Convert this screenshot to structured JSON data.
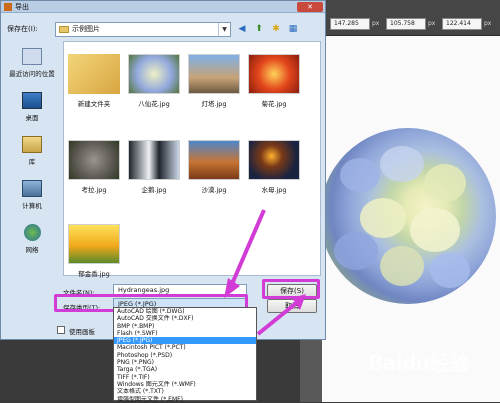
{
  "dialog": {
    "title": "导出",
    "lookin_label": "保存在(I):",
    "current_folder": "示例图片",
    "places": [
      {
        "label": "最近访问的位置"
      },
      {
        "label": "桌面"
      },
      {
        "label": "库"
      },
      {
        "label": "计算机"
      },
      {
        "label": "网络"
      }
    ],
    "files": [
      {
        "name": "新建文件夹"
      },
      {
        "name": "八仙花.jpg"
      },
      {
        "name": "灯塔.jpg"
      },
      {
        "name": "菊花.jpg"
      },
      {
        "name": "考拉.jpg"
      },
      {
        "name": "企鹅.jpg"
      },
      {
        "name": "沙漠.jpg"
      },
      {
        "name": "水母.jpg"
      },
      {
        "name": "郁金香.jpg"
      }
    ],
    "filename_label": "文件名(N):",
    "filename_value": "Hydrangeas.jpg",
    "savetype_label": "保存类型(T):",
    "savetype_value": "JPEG (*.JPG)",
    "use_artboards_label": "使用画板",
    "save_button": "保存(S)",
    "cancel_button": "取消",
    "file_types": [
      "AutoCAD 绘图 (*.DWG)",
      "AutoCAD 交换文件 (*.DXF)",
      "BMP (*.BMP)",
      "Flash (*.SWF)",
      "JPEG (*.JPG)",
      "Macintosh PICT (*.PCT)",
      "Photoshop (*.PSD)",
      "PNG (*.PNG)",
      "Targa (*.TGA)",
      "TIFF (*.TIF)",
      "Windows 图元文件 (*.WMF)",
      "文本格式 (*.TXT)",
      "增强型图元文件 (*.EMF)"
    ],
    "selected_type_index": 4
  },
  "app_toolbar": {
    "x_value": "147.285",
    "y_value": "105.758",
    "w_value": "122.414",
    "unit": "px"
  },
  "watermark": {
    "text": "Baidu经验",
    "sub": "jingyan.baidu.com"
  },
  "colors": {
    "highlight": "#d23bd6",
    "selection": "#3399ff"
  }
}
